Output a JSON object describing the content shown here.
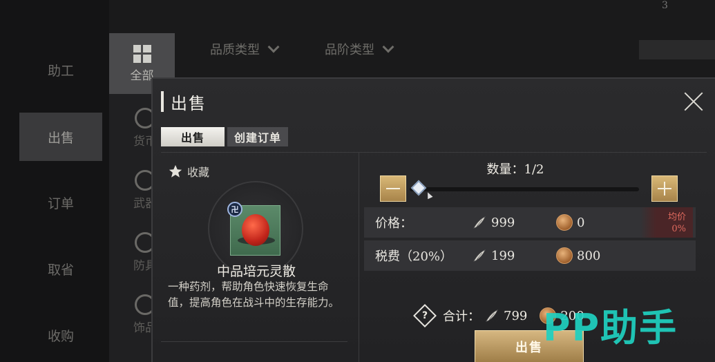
{
  "background": {
    "sidebar": [
      "助工",
      "出售",
      "订单",
      "取省",
      "收购"
    ],
    "sidebar_active_index": 1,
    "category_all": "全部",
    "categories": [
      "货币",
      "武器",
      "防具",
      "饰品"
    ],
    "filters": [
      "品质类型",
      "品阶类型"
    ],
    "top_number": "3"
  },
  "dialog": {
    "title": "出售",
    "tabs": [
      {
        "label": "出售",
        "active": true
      },
      {
        "label": "创建订单",
        "active": false
      }
    ],
    "favorite_label": "收藏",
    "item": {
      "grade_badge": "卍",
      "name": "中品培元灵散",
      "description": "一种药剂，帮助角色快速恢复生命值，提高角色在战斗中的生存能力。"
    },
    "quantity_label": "数量：1/2",
    "quantity_fraction": 0.5,
    "price_row": {
      "label": "价格：",
      "feather_value": "999",
      "coin_value": "0",
      "avg_label": "均价",
      "avg_value": "0%"
    },
    "tax_row": {
      "label": "税费（20%）",
      "feather_value": "199",
      "coin_value": "800"
    },
    "total": {
      "help_icon": "?",
      "label": "合计：",
      "feather_value": "799",
      "coin_value": "200"
    },
    "sell_button": "出售"
  },
  "watermark": "PP助手",
  "colors": {
    "gold_button": "#c7a364",
    "avg_red": "#e06a5e",
    "watermark": "#1fd1c1"
  }
}
